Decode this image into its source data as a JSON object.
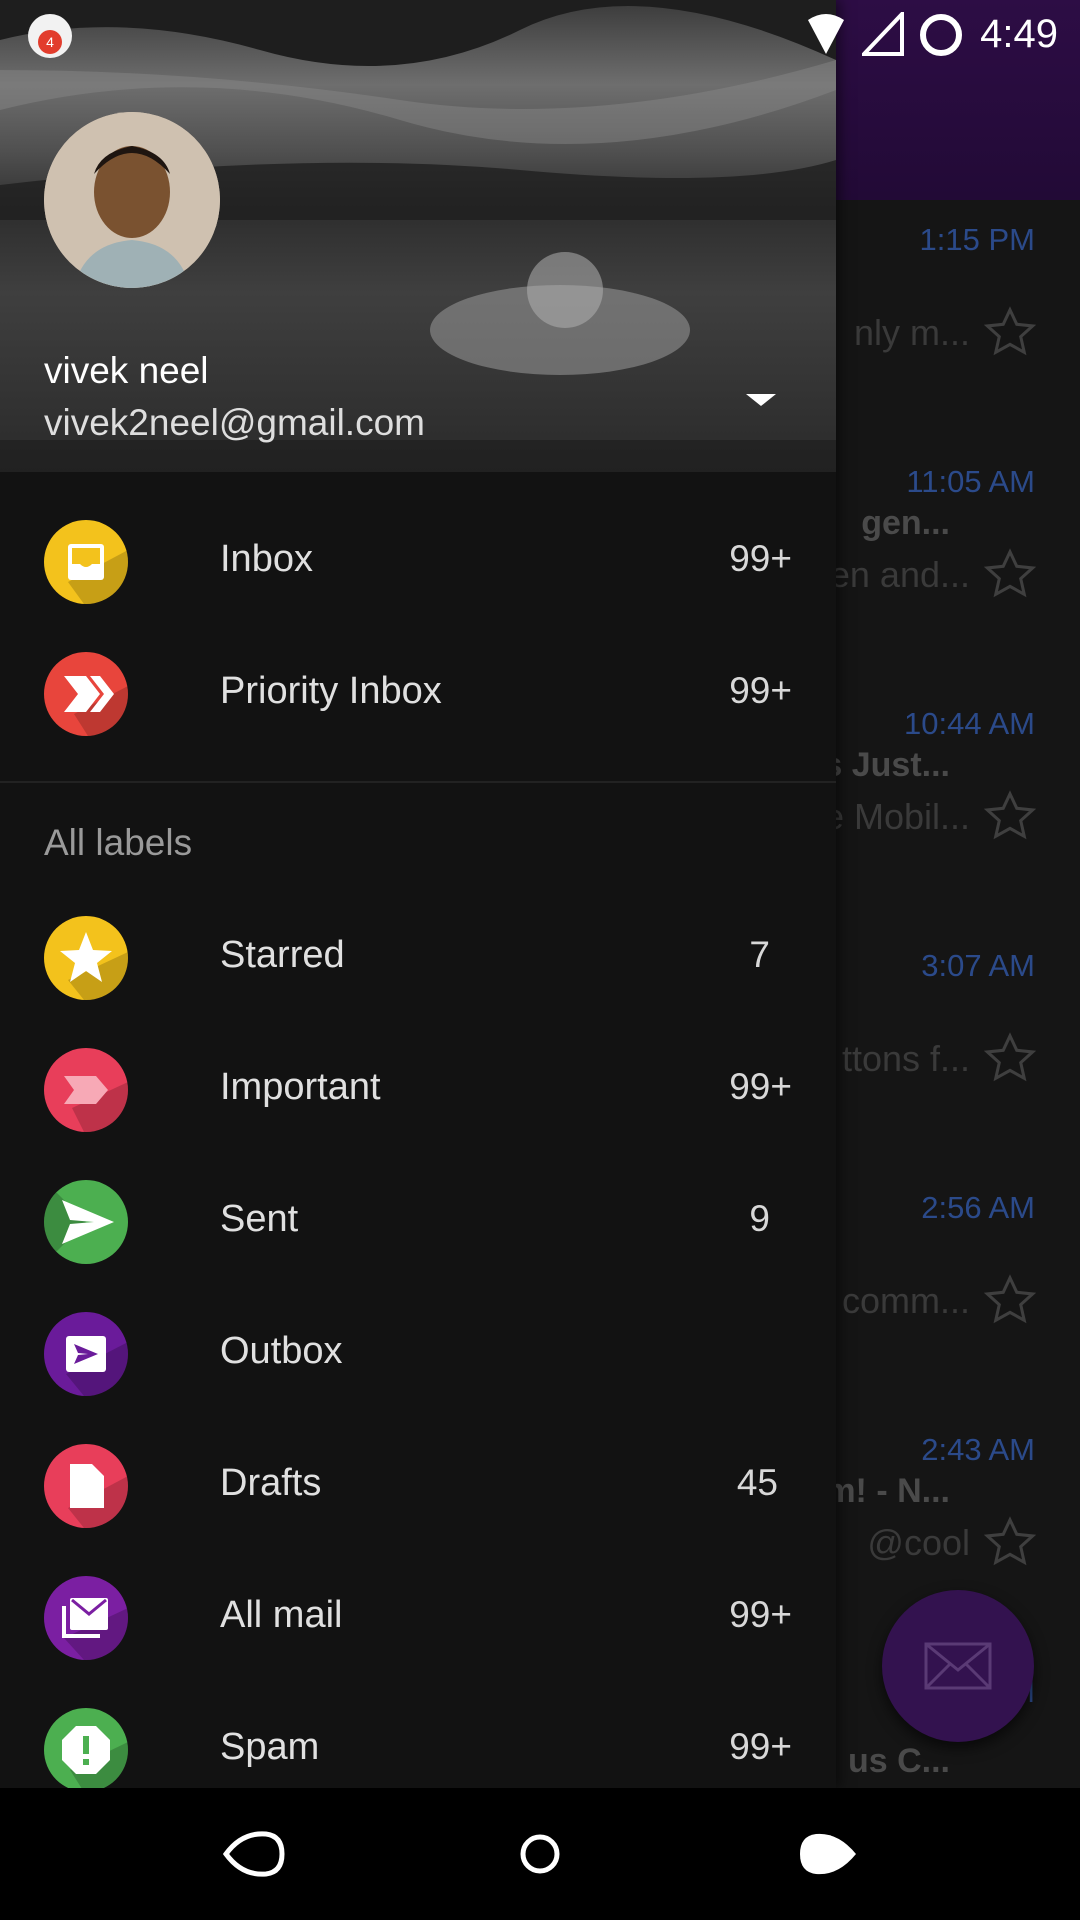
{
  "status_bar": {
    "time": "4:49",
    "notification_count": "4"
  },
  "background_list": {
    "rows": [
      {
        "time": "1:15 PM",
        "subject": "",
        "snippet": "nly m..."
      },
      {
        "time": "11:05 AM",
        "subject": "gen...",
        "snippet": "en and..."
      },
      {
        "time": "10:44 AM",
        "subject": "s Just...",
        "snippet": "e Mobil..."
      },
      {
        "time": "3:07 AM",
        "subject": "",
        "snippet": "ttons f..."
      },
      {
        "time": "2:56 AM",
        "subject": "",
        "snippet": "comm..."
      },
      {
        "time": "2:43 AM",
        "subject": "m! - N...",
        "snippet": "@cool"
      },
      {
        "time": "AM",
        "subject": "us C...",
        "snippet": ""
      }
    ]
  },
  "account": {
    "name": "vivek neel",
    "email": "vivek2neel@gmail.com"
  },
  "primary_items": [
    {
      "label": "Inbox",
      "count": "99+",
      "icon": "inbox-icon",
      "color": "#f3c21c"
    },
    {
      "label": "Priority Inbox",
      "count": "99+",
      "icon": "priority-inbox-icon",
      "color": "#e8453c"
    }
  ],
  "labels_heading": "All labels",
  "label_items": [
    {
      "label": "Starred",
      "count": "7",
      "icon": "star-icon",
      "color": "#f3c21c"
    },
    {
      "label": "Important",
      "count": "99+",
      "icon": "important-icon",
      "color": "#e83e5a"
    },
    {
      "label": "Sent",
      "count": "9",
      "icon": "send-icon",
      "color": "#4caf50"
    },
    {
      "label": "Outbox",
      "count": "",
      "icon": "outbox-icon",
      "color": "#7b1fa2"
    },
    {
      "label": "Drafts",
      "count": "45",
      "icon": "drafts-icon",
      "color": "#e83e5a"
    },
    {
      "label": "All mail",
      "count": "99+",
      "icon": "all-mail-icon",
      "color": "#7b1fa2"
    },
    {
      "label": "Spam",
      "count": "99+",
      "icon": "spam-icon",
      "color": "#4caf50"
    }
  ]
}
